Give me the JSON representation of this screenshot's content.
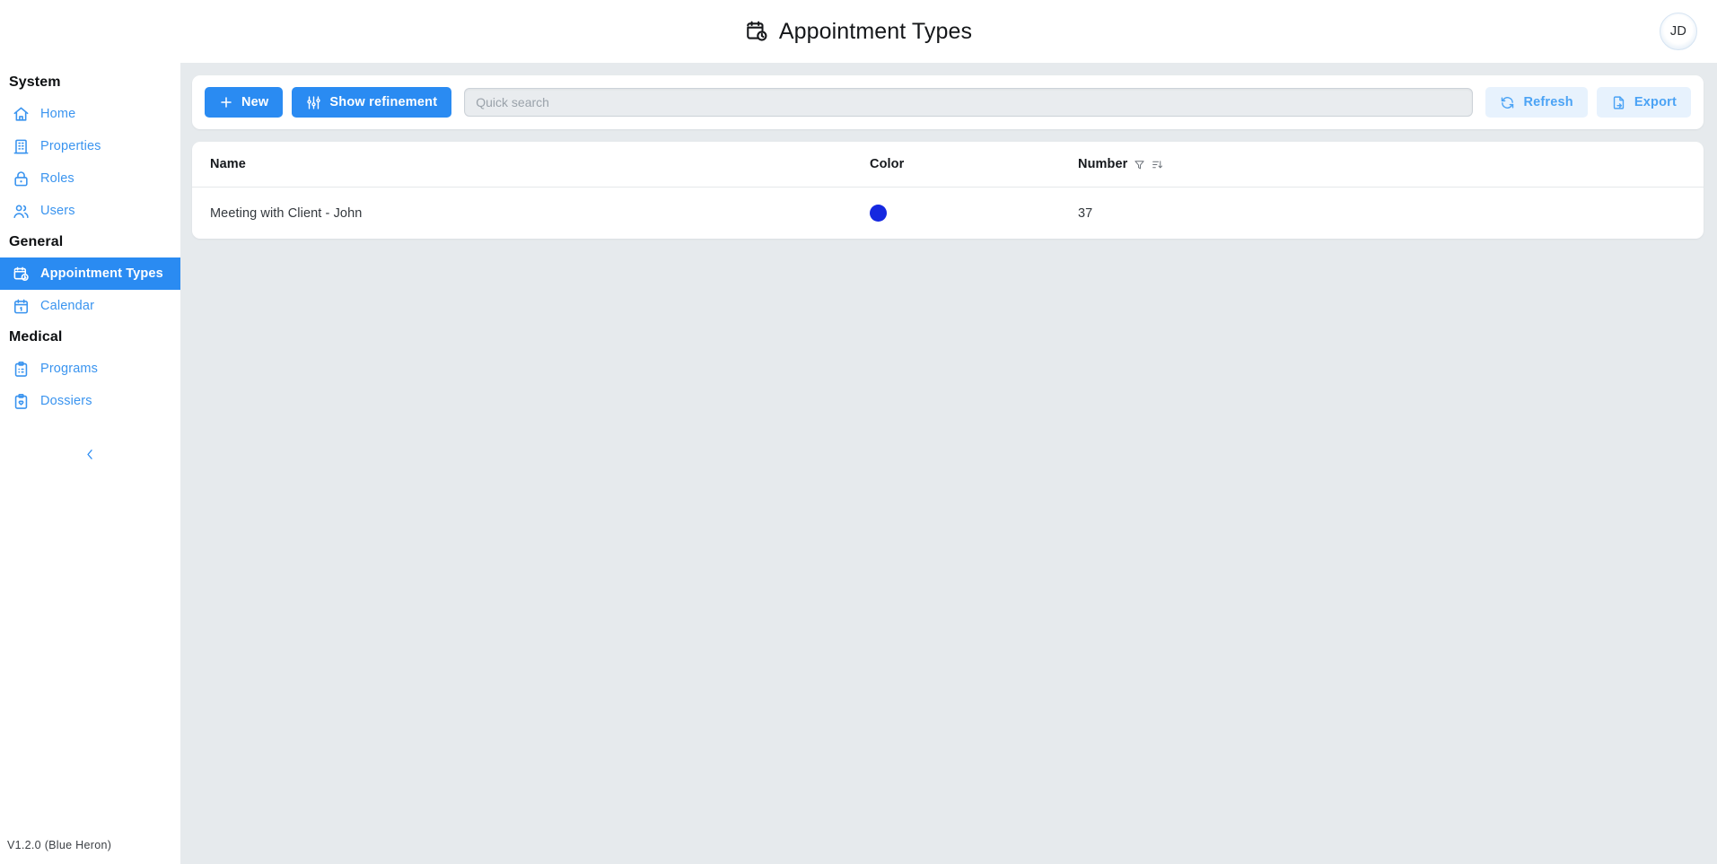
{
  "app": {
    "logo_name": "hexagon-logo",
    "version": "V1.2.0 (Blue Heron)"
  },
  "header": {
    "title": "Appointment Types",
    "icon": "calendar-clock-icon",
    "avatar_initials": "JD"
  },
  "sidebar": {
    "collapse_label": "",
    "groups": [
      {
        "label": "System",
        "items": [
          {
            "label": "Home",
            "icon": "home-icon",
            "active": false
          },
          {
            "label": "Properties",
            "icon": "building-icon",
            "active": false
          },
          {
            "label": "Roles",
            "icon": "lock-icon",
            "active": false
          },
          {
            "label": "Users",
            "icon": "users-icon",
            "active": false
          }
        ]
      },
      {
        "label": "General",
        "items": [
          {
            "label": "Appointment Types",
            "icon": "calendar-clock-icon",
            "active": true
          },
          {
            "label": "Calendar",
            "icon": "calendar-icon",
            "active": false
          }
        ]
      },
      {
        "label": "Medical",
        "items": [
          {
            "label": "Programs",
            "icon": "clipboard-list-icon",
            "active": false
          },
          {
            "label": "Dossiers",
            "icon": "clipboard-heart-icon",
            "active": false
          }
        ]
      }
    ]
  },
  "toolbar": {
    "new_label": "New",
    "refinement_label": "Show refinement",
    "refresh_label": "Refresh",
    "export_label": "Export",
    "search_value": "",
    "search_placeholder": "Quick search"
  },
  "table": {
    "columns": [
      {
        "label": "Name",
        "filterable": false,
        "sortable": false
      },
      {
        "label": "Color",
        "filterable": false,
        "sortable": false
      },
      {
        "label": "Number",
        "filterable": true,
        "sortable": true
      }
    ],
    "rows": [
      {
        "name": "Meeting with Client - John",
        "color": "#1528e0",
        "number": "37"
      }
    ]
  },
  "colors": {
    "accent": "#2a8bf2",
    "accent_soft_bg": "#e7f2fd",
    "accent_soft_text": "#4ba3f5",
    "nav_link": "#3a94ef",
    "page_bg": "#e6eaed",
    "card_bg": "#ffffff"
  }
}
